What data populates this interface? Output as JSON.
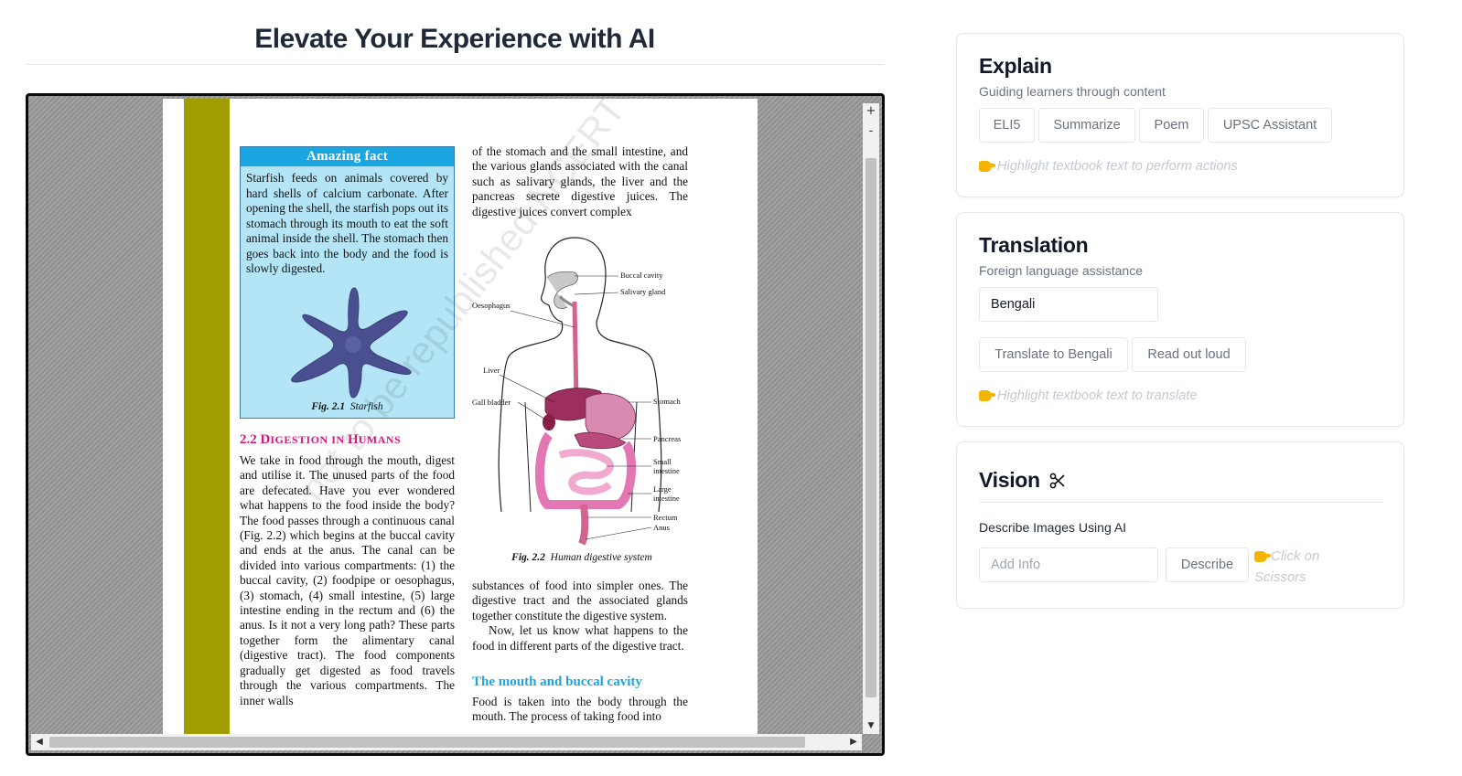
{
  "header": {
    "title": "Elevate Your Experience with AI"
  },
  "viewer": {
    "zoom_in": "+",
    "zoom_out": "-",
    "scroll_down": "▼",
    "scroll_left": "◀",
    "scroll_right": "▶",
    "fact_box": {
      "heading": "Amazing fact",
      "text": "Starfish feeds on animals covered by hard shells of calcium carbonate. After opening the shell, the starfish pops out its stomach through its mouth to eat the soft animal inside the shell. The stomach then goes back into the body and the food is slowly digested.",
      "figure_label": "Fig. 2.1",
      "figure_caption": "Starfish"
    },
    "section": {
      "number": "2.2",
      "title_a": "D",
      "title_b": "IGESTION IN ",
      "title_c": "H",
      "title_d": "UMANS"
    },
    "left_column": "We take in food through the mouth, digest and utilise it. The unused parts of the food are defecated. Have you ever wondered what happens to the food inside the body? The food passes through a continuous canal (Fig. 2.2) which begins at the buccal cavity and ends at the anus. The canal can be divided into various compartments: (1) the buccal cavity, (2) foodpipe or oesophagus, (3) stomach, (4) small intestine, (5) large intestine ending in the rectum and (6) the anus. Is it not a very long path? These parts together form the alimentary canal (digestive tract). The food components gradually get digested as food travels through the various compartments. The inner walls",
    "right_top": "of the stomach and the small intestine, and the various glands associated with the canal such as salivary glands, the liver and the pancreas secrete digestive juices. The digestive juices convert complex",
    "diagram_labels": {
      "buccal": "Buccal cavity",
      "salivary": "Salivary gland",
      "oesophagus": "Oesophagus",
      "liver": "Liver",
      "gall": "Gall bladder",
      "stomach": "Stomach",
      "pancreas": "Pancreas",
      "small1": "Small",
      "small2": "intestine",
      "large1": "Large",
      "large2": "intestine",
      "rectum": "Rectum",
      "anus": "Anus"
    },
    "diagram_caption_label": "Fig. 2.2",
    "diagram_caption": "Human digestive system",
    "right_bottom_1": "substances of food into simpler ones. The digestive tract and the associated glands together constitute the digestive system.",
    "right_bottom_2": "Now, let us know what happens to the food in different parts of the digestive tract.",
    "subheading": "The mouth and buccal cavity",
    "right_end": "Food is taken into the body through the mouth. The process of taking food into",
    "watermark": "not to be republished NCERT"
  },
  "explain": {
    "title": "Explain",
    "subtitle": "Guiding learners through content",
    "buttons": [
      "ELI5",
      "Summarize",
      "Poem",
      "UPSC Assistant"
    ],
    "hint": "Highlight textbook text to perform actions"
  },
  "translation": {
    "title": "Translation",
    "subtitle": "Foreign language assistance",
    "language_value": "Bengali",
    "translate_button": "Translate to Bengali",
    "read_button": "Read out loud",
    "hint": "Highlight textbook text to translate"
  },
  "vision": {
    "title": "Vision",
    "icon": "scissors-icon",
    "label": "Describe Images Using AI",
    "input_placeholder": "Add Info",
    "describe_button": "Describe",
    "hint_line1": "Click on",
    "hint_line2": "Scissors"
  }
}
